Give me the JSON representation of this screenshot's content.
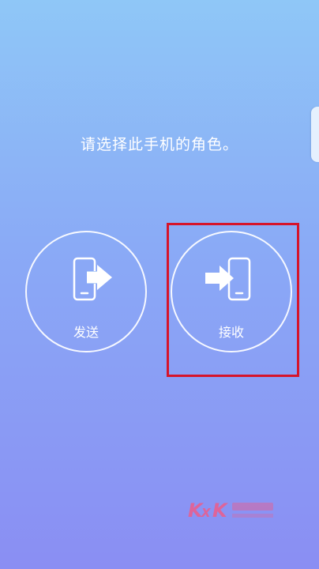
{
  "prompt": {
    "text": "请选择此手机的角色。"
  },
  "roles": [
    {
      "label": "发送",
      "icon": "phone-send-icon"
    },
    {
      "label": "接收",
      "icon": "phone-receive-icon"
    }
  ],
  "highlight": {
    "color": "#d6142a"
  },
  "watermark": {
    "text": "KXK"
  },
  "colors": {
    "gradient_top": "#8fc7f7",
    "gradient_bottom": "#8a8ef3",
    "foreground": "#ffffff"
  }
}
